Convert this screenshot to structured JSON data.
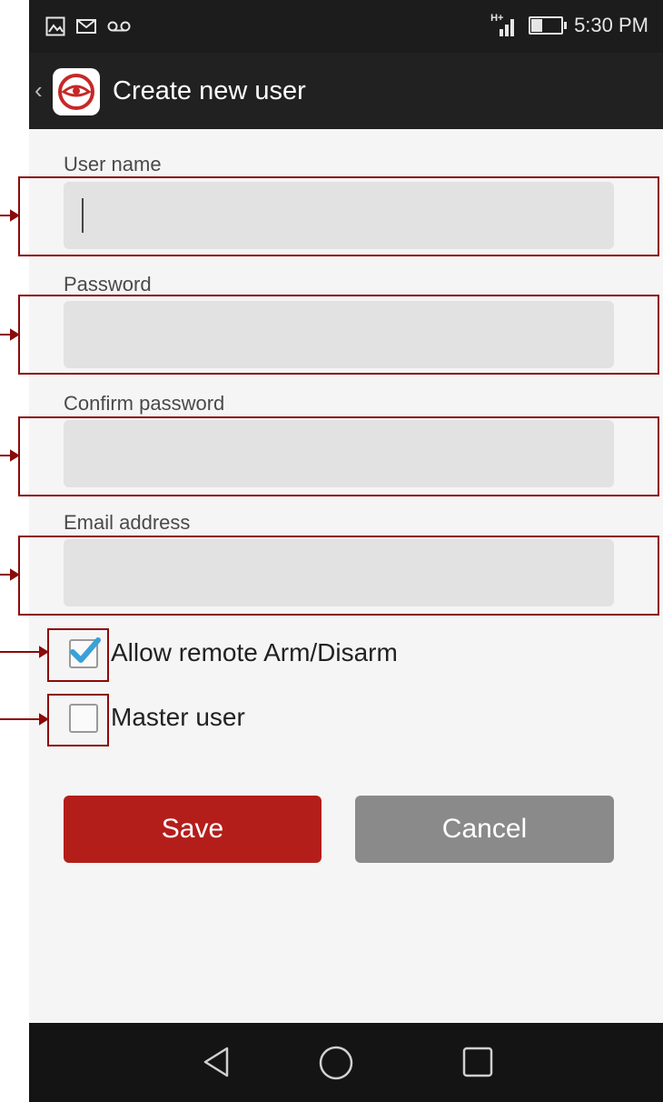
{
  "status_bar": {
    "left_icons": [
      "gallery-icon",
      "message-icon",
      "voicemail-icon"
    ],
    "network": "H+",
    "time": "5:30 PM",
    "battery_level": 0.35
  },
  "action_bar": {
    "title": "Create new user"
  },
  "form": {
    "username_label": "User name",
    "username_value": "",
    "password_label": "Password",
    "password_value": "",
    "confirm_label": "Confirm password",
    "confirm_value": "",
    "email_label": "Email address",
    "email_value": ""
  },
  "checkboxes": {
    "remote_label": "Allow remote Arm/Disarm",
    "remote_checked": true,
    "master_label": "Master user",
    "master_checked": false
  },
  "buttons": {
    "save": "Save",
    "cancel": "Cancel"
  },
  "colors": {
    "save": "#b41e1a",
    "cancel": "#8a8a8a",
    "check": "#3aa0d8",
    "annotation": "#8b0a0a"
  },
  "nav": [
    "back-icon",
    "home-icon",
    "recents-icon"
  ]
}
